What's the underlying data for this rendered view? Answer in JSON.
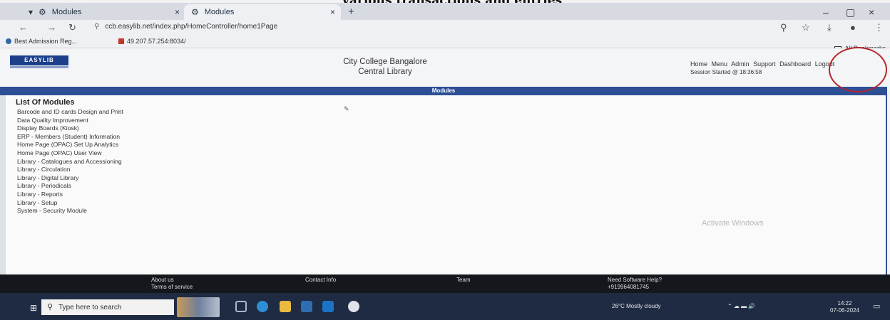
{
  "caption": "various transactions and entries",
  "browser": {
    "tabs": [
      {
        "label": "Modules",
        "active": false
      },
      {
        "label": "Modules",
        "active": true
      }
    ],
    "new_tab": "+",
    "controls": {
      "minimize": "–",
      "maximize": "▢",
      "close": "×"
    },
    "url": "ccb.easylib.net/index.php/HomeController/home1Page",
    "bookmarks": [
      {
        "label": "Best Admission Reg..."
      },
      {
        "label": "49.207.57.254:8034/"
      }
    ],
    "all_bookmarks": "All Bookmarks"
  },
  "site": {
    "logo_text": "EASYLIB",
    "college_name": "City College Bangalore",
    "library_name": "Central Library",
    "top_nav": [
      "Home",
      "Menu",
      "Admin",
      "Support",
      "Dashboard",
      "Logout"
    ],
    "session": "Session Started @ 18:36:58"
  },
  "modules": {
    "bar_title": "Modules",
    "heading": "List Of Modules",
    "items": [
      "Barcode and ID cards Design and Print",
      "Data Quality Improvement",
      "Display Boards (Kiosk)",
      "ERP - Members (Student) Information",
      "Home Page (OPAC) Set Up Analytics",
      "Home Page (OPAC) User View",
      "Library - Catalogues and Accessioning",
      "Library - Circulation",
      "Library - Digital Library",
      "Library - Periodicals",
      "Library - Reports",
      "Library - Setup",
      "System - Security Module"
    ],
    "edit_icon_name": "edit-icon"
  },
  "watermark": "Activate Windows",
  "footer": {
    "about": [
      "About us",
      "Terms of service"
    ],
    "contact": "Contact Info",
    "team": "Team",
    "help": [
      "Need Software Help?",
      "+919964081745"
    ]
  },
  "taskbar": {
    "search_placeholder": "Type here to search",
    "weather": "26°C  Mostly cloudy",
    "time": "14:22",
    "date": "07-06-2024"
  },
  "colors": {
    "module_bar": "#2c4f96",
    "taskbar": "#1e2b43",
    "footer": "#14181d",
    "annotation_circle": "#b3262d"
  }
}
